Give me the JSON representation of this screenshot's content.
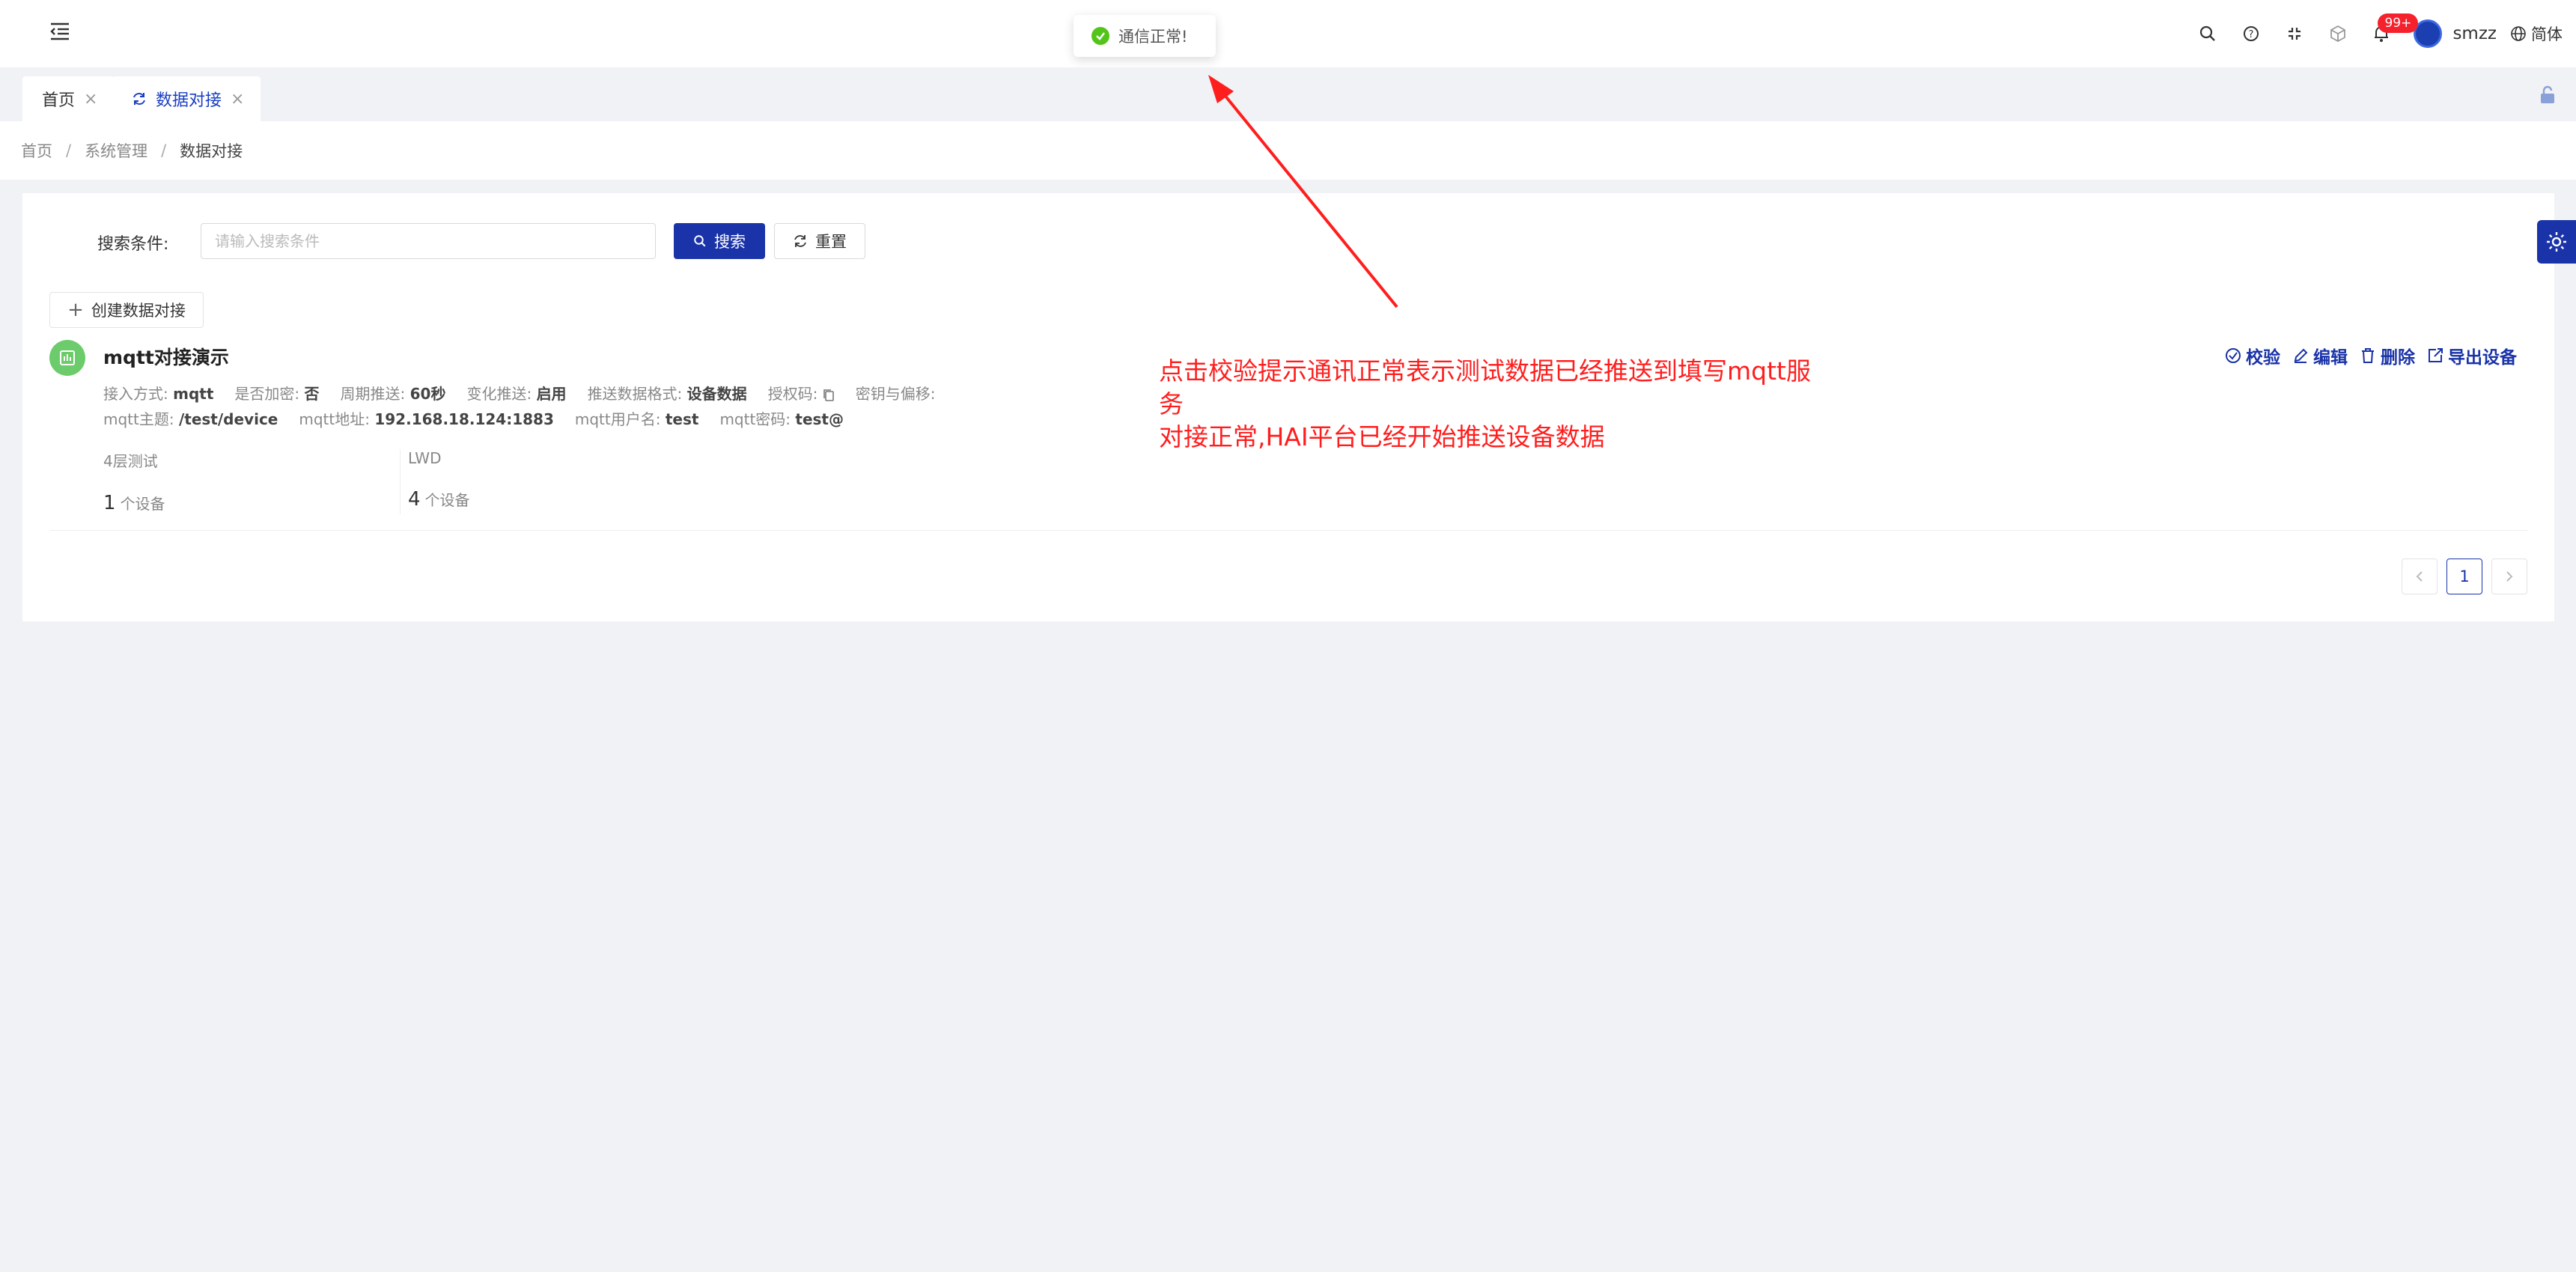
{
  "header": {
    "icons": [
      "menu-fold-icon",
      "search-icon",
      "help-icon",
      "fullscreen-icon",
      "cube-icon",
      "bell-icon"
    ],
    "notification_badge": "99+",
    "username": "smzz",
    "language": "简体"
  },
  "toast": {
    "message": "通信正常!",
    "type": "success",
    "color": "#52c41a"
  },
  "tabs": [
    {
      "label": "首页",
      "active": false
    },
    {
      "label": "数据对接",
      "active": true
    }
  ],
  "breadcrumb": [
    "首页",
    "系统管理",
    "数据对接"
  ],
  "search": {
    "label": "搜索条件:",
    "placeholder": "请输入搜索条件",
    "search_button": "搜索",
    "reset_button": "重置"
  },
  "create_button": "创建数据对接",
  "item": {
    "title": "mqtt对接演示",
    "meta_row_1": [
      {
        "label": "接入方式:",
        "value": "mqtt"
      },
      {
        "label": "是否加密:",
        "value": "否"
      },
      {
        "label": "周期推送:",
        "value": "60秒"
      },
      {
        "label": "变化推送:",
        "value": "启用"
      },
      {
        "label": "推送数据格式:",
        "value": "设备数据"
      },
      {
        "label": "授权码:",
        "value": ""
      },
      {
        "label": "密钥与偏移:",
        "value": ""
      }
    ],
    "meta_row_2": [
      {
        "label": "mqtt主题:",
        "value": "/test/device"
      },
      {
        "label": "mqtt地址:",
        "value": "192.168.18.124:1883"
      },
      {
        "label": "mqtt用户名:",
        "value": "test"
      },
      {
        "label": "mqtt密码:",
        "value": "test@"
      }
    ],
    "actions": [
      "校验",
      "编辑",
      "删除",
      "导出设备"
    ],
    "groups": [
      {
        "name": "4层测试",
        "count": "1",
        "unit": "个设备"
      },
      {
        "name": "LWD",
        "count": "4",
        "unit": "个设备"
      }
    ]
  },
  "pagination": {
    "current": "1"
  },
  "annotation": {
    "line1": "点击校验提示通讯正常表示测试数据已经推送到填写mqtt服务",
    "line2": "对接正常,HAI平台已经开始推送设备数据",
    "color": "#ff1e1e"
  },
  "colors": {
    "primary": "#1a33a8",
    "accent_icon": "#6ccb6b"
  }
}
